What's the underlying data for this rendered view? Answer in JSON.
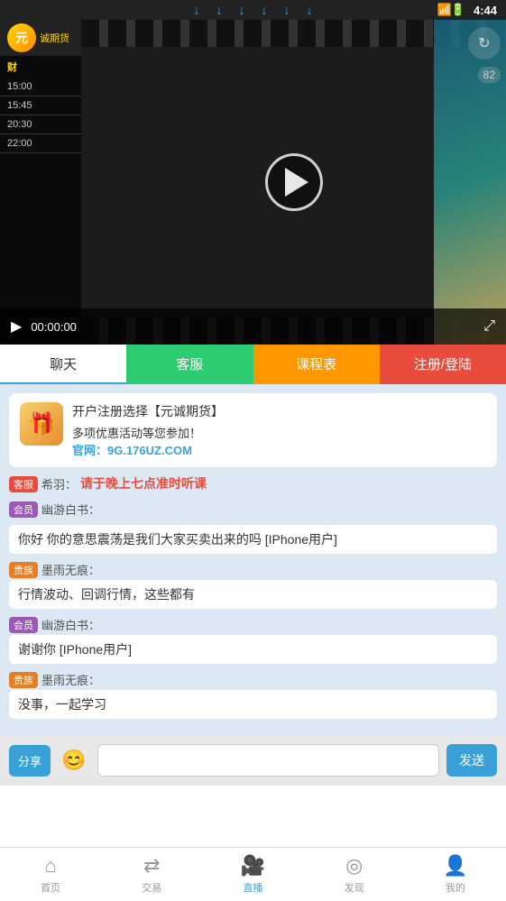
{
  "status": {
    "time": "4:44",
    "signal": "WiFi",
    "battery": "charging"
  },
  "download_arrows": [
    "↓",
    "↓",
    "↓",
    "↓",
    "↓",
    "↓"
  ],
  "video": {
    "logo_text": "元",
    "brand": "诚期货",
    "schedule_title": "财",
    "schedule_items": [
      {
        "time": "15:00",
        "label": ""
      },
      {
        "time": "15:45",
        "label": ""
      },
      {
        "time": "20:30",
        "label": ""
      },
      {
        "time": "22:00",
        "label": ""
      }
    ],
    "time_display": "00:00:00",
    "score": "82"
  },
  "tabs": {
    "chat": "聊天",
    "service": "客服",
    "schedule": "课程表",
    "register": "注册/登陆"
  },
  "chat": {
    "announcement": {
      "line1": "开户注册选择【元诚期货】",
      "line2": "多项优惠活动等您参加！",
      "url": "官网：9G.176UZ.COM"
    },
    "messages": [
      {
        "badge": "客服",
        "badge_type": "customer",
        "username": "希羽：",
        "text": "请于晚上七点准时听课",
        "text_type": "highlight"
      },
      {
        "badge": "会员",
        "badge_type": "vip",
        "username": "幽游白书：",
        "text": ""
      },
      {
        "full": "你好 你的意思震荡是我们大家买卖出来的吗 [IPhone用户]"
      },
      {
        "badge": "贵族",
        "badge_type": "noble",
        "username": "墨雨无痕：",
        "text": "行情波动、回调行情，这些都有"
      },
      {
        "badge": "会员",
        "badge_type": "vip",
        "username": "幽游白书：",
        "text": "谢谢你 [IPhone用户]"
      },
      {
        "badge": "贵族",
        "badge_type": "noble",
        "username": "墨雨无痕：",
        "text": "没事，一起学习"
      }
    ]
  },
  "input": {
    "share": "分享",
    "placeholder": "",
    "send": "发送"
  },
  "bottom_nav": [
    {
      "label": "首页",
      "icon": "⌂",
      "active": false
    },
    {
      "label": "交易",
      "icon": "↔",
      "active": false
    },
    {
      "label": "直播",
      "icon": "🎥",
      "active": true
    },
    {
      "label": "发现",
      "icon": "◎",
      "active": false
    },
    {
      "label": "我的",
      "icon": "👤",
      "active": false
    }
  ]
}
